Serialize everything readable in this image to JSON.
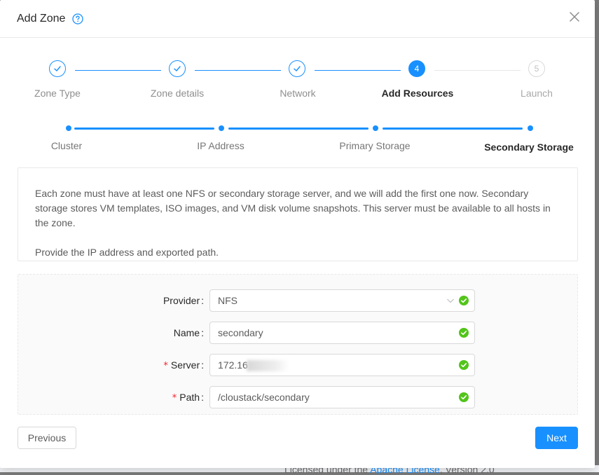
{
  "modal": {
    "title": "Add Zone"
  },
  "steps": [
    {
      "label": "Zone Type",
      "status": "done"
    },
    {
      "label": "Zone details",
      "status": "done"
    },
    {
      "label": "Network",
      "status": "done"
    },
    {
      "label": "Add Resources",
      "status": "active",
      "number": "4"
    },
    {
      "label": "Launch",
      "status": "wait",
      "number": "5"
    }
  ],
  "substeps": [
    {
      "label": "Cluster"
    },
    {
      "label": "IP Address"
    },
    {
      "label": "Primary Storage"
    },
    {
      "label": "Secondary Storage",
      "active": true
    }
  ],
  "description": {
    "para1": "Each zone must have at least one NFS or secondary storage server, and we will add the first one now. Secondary storage stores VM templates, ISO images, and VM disk volume snapshots. This server must be available to all hosts in the zone.",
    "para2": "Provide the IP address and exported path."
  },
  "form": {
    "provider": {
      "label": "Provider",
      "value": "NFS"
    },
    "name": {
      "label": "Name",
      "value": "secondary"
    },
    "server": {
      "label": "Server",
      "value": "172.16",
      "required": true
    },
    "path": {
      "label": "Path",
      "value": "/cloustack/secondary",
      "required": true
    },
    "required_mark": "*",
    "colon": ":"
  },
  "buttons": {
    "previous": "Previous",
    "next": "Next"
  },
  "background": {
    "footer_prefix": "Licensed under the ",
    "footer_link": "Apache License",
    "footer_suffix": ", Version 2.0"
  },
  "colors": {
    "primary": "#1890ff",
    "success": "#52c41a",
    "required": "#f5222d"
  }
}
